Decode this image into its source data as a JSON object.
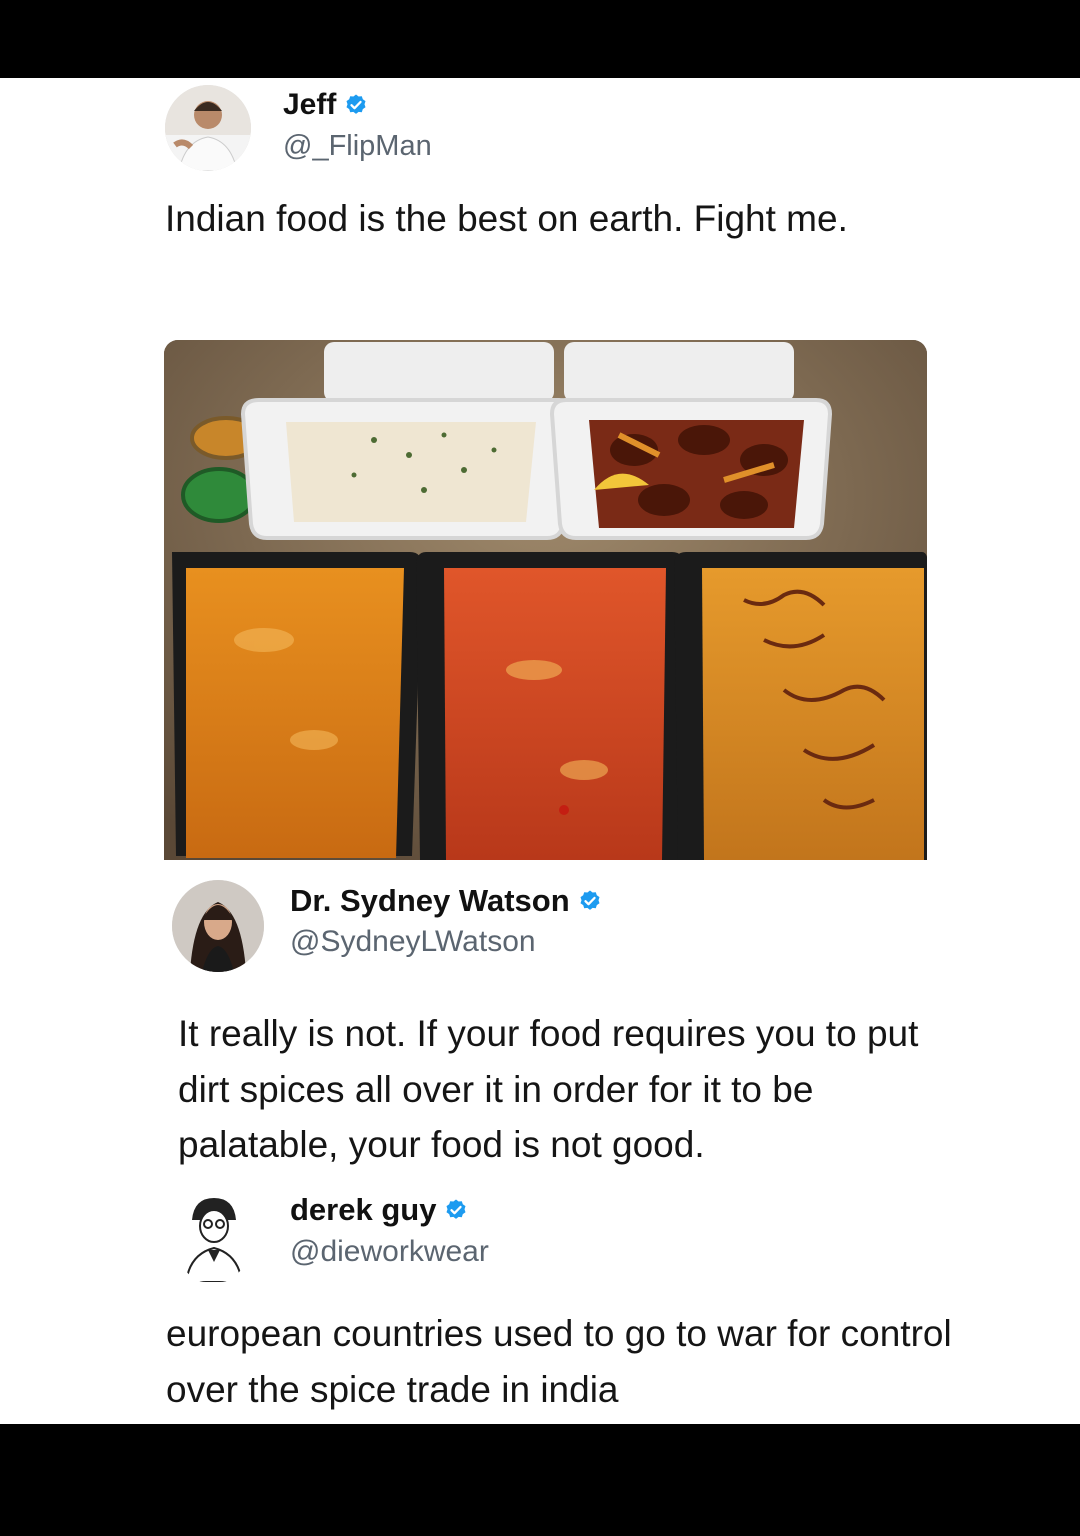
{
  "posts": [
    {
      "author": "Jeff",
      "handle": "@_FlipMan",
      "verified": true,
      "text": "Indian food is the best on earth. Fight me."
    },
    {
      "author": "Dr. Sydney Watson",
      "handle": "@SydneyLWatson",
      "verified": true,
      "text": "It really is not. If your food requires you to put dirt spices all over it in order for it to be palatable, your food is not good."
    },
    {
      "author": "derek guy",
      "handle": "@dieworkwear",
      "verified": true,
      "text": "european countries used to go to war for control over the spice trade in india"
    }
  ],
  "colors": {
    "verified_badge": "#1d9bf0",
    "handle": "#5b6570"
  },
  "icons": {
    "verified": "verified-badge-icon"
  }
}
